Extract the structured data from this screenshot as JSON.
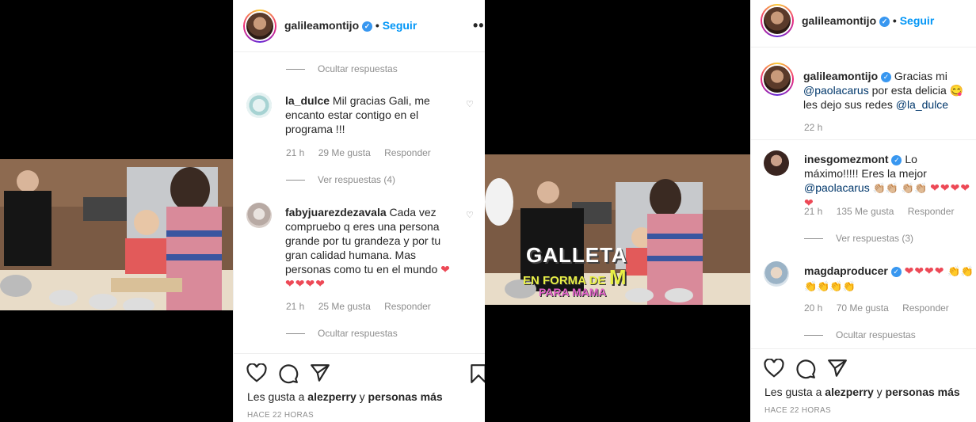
{
  "left": {
    "header": {
      "username": "galileamontijo",
      "follow": "Seguir",
      "more": "•••"
    },
    "top_toggle": "Ocultar respuestas",
    "comments": [
      {
        "user": "la_dulce",
        "text": "Mil gracias Gali, me encanto estar contigo en el programa !!!",
        "time": "21 h",
        "likes": "29 Me gusta",
        "reply": "Responder",
        "toggle": "Ver respuestas (4)"
      },
      {
        "user": "fabyjuarezdezavala",
        "text": "Cada vez compruebo q eres una persona grande por tu grandeza y por tu gran calidad humana. Mas personas como tu en el mundo",
        "emoji": "❤❤❤❤❤",
        "time": "21 h",
        "likes": "25 Me gusta",
        "reply": "Responder",
        "toggle": "Ocultar respuestas"
      }
    ],
    "likes_prefix": "Les gusta a",
    "likes_user": "alezperry",
    "likes_y": "y",
    "likes_rest": "personas más",
    "time_ago": "HACE 22 HORAS"
  },
  "video_overlay": {
    "line1": "GALLETA",
    "line2": "EN FORMA DE",
    "letter": "M",
    "line3": "PARA MAMA"
  },
  "right": {
    "header": {
      "username": "galileamontijo",
      "follow": "Seguir"
    },
    "caption": {
      "user": "galileamontijo",
      "text1": "Gracias mi",
      "mention1": "@paolacarus",
      "text2": "por esta delicia",
      "emoji": "😋",
      "text3": "les dejo sus redes",
      "mention2": "@la_dulce",
      "time": "22 h"
    },
    "comments": [
      {
        "user": "inesgomezmont",
        "text": "Lo máximo!!!!! Eres la mejor",
        "mention": "@paolacarus",
        "emoji1": "👏🏼👏🏼",
        "emoji2": "👏🏼👏🏼",
        "hearts": "❤❤❤❤❤",
        "time": "21 h",
        "likes": "135 Me gusta",
        "reply": "Responder",
        "toggle": "Ver respuestas (3)"
      },
      {
        "user": "magdaproducer",
        "hearts": "❤❤❤❤",
        "emoji": "👏👏👏👏👏👏",
        "time": "20 h",
        "likes": "70 Me gusta",
        "reply": "Responder",
        "toggle": "Ocultar respuestas"
      }
    ],
    "likes_prefix": "Les gusta a",
    "likes_user": "alezperry",
    "likes_y": "y",
    "likes_rest": "personas más",
    "time_ago": "HACE 22 HORAS"
  },
  "colors": {
    "accent": "#0095f6",
    "verified": "#3897f0",
    "heart": "#ed4956",
    "meta": "#8e8e8e"
  }
}
